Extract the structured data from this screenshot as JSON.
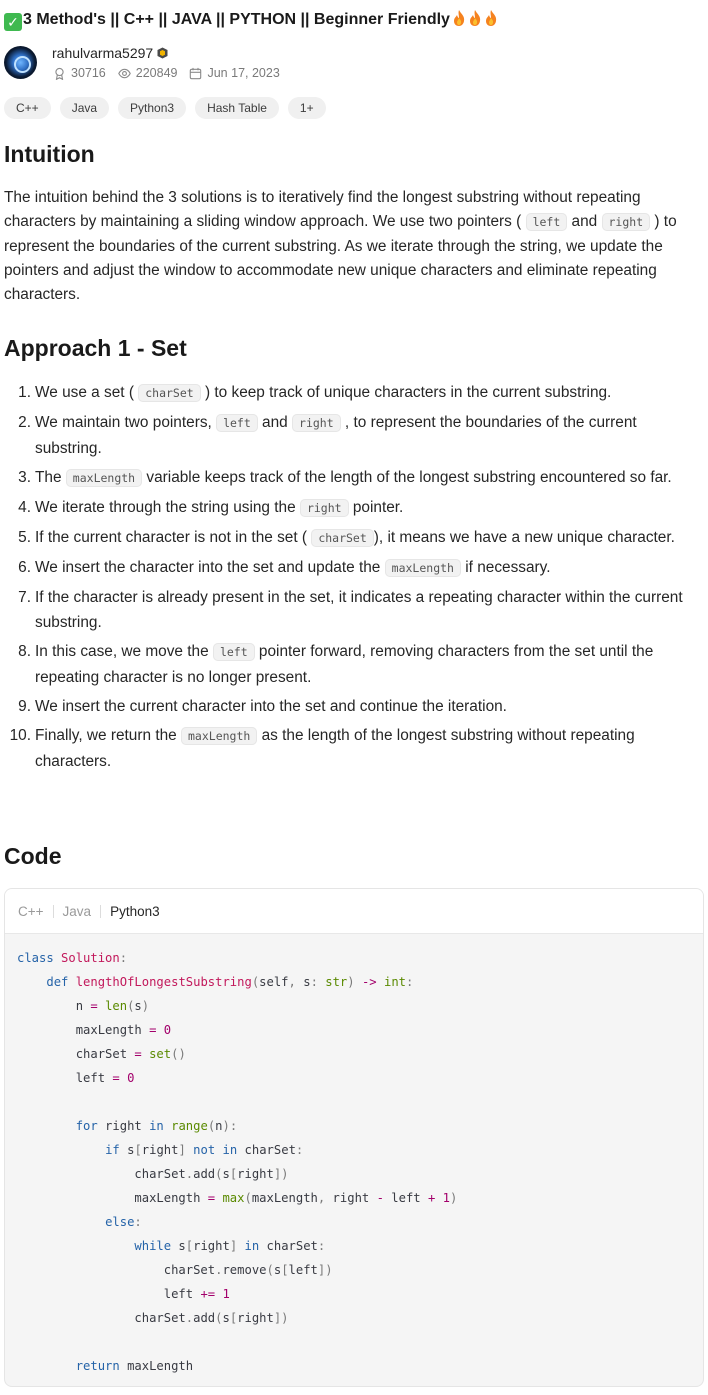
{
  "post": {
    "title": "3 Method's || C++ || JAVA || PYTHON || Beginner Friendly",
    "author": "rahulvarma5297",
    "reputation": "30716",
    "views": "220849",
    "date": "Jun 17, 2023",
    "tags": [
      "C++",
      "Java",
      "Python3",
      "Hash Table",
      "1+"
    ]
  },
  "sections": {
    "intuition_heading": "Intuition",
    "approach_heading": "Approach 1 - Set",
    "code_heading": "Code"
  },
  "intuition": {
    "t1": "The intuition behind the 3 solutions is to iteratively find the longest substring without repeating characters by maintaining a sliding window approach. We use two pointers (",
    "c1": "left",
    "t2": " and ",
    "c2": "right",
    "t3": ") to represent the boundaries of the current substring. As we iterate through the string, we update the pointers and adjust the window to accommodate new unique characters and eliminate repeating characters."
  },
  "steps": [
    {
      "num": "1.",
      "a": "We use a set (",
      "c": "charSet",
      "b": ") to keep track of unique characters in the current substring."
    },
    {
      "num": "2.",
      "a": "We maintain two pointers, ",
      "c": "left",
      "m": " and ",
      "c2": "right",
      "b": ", to represent the boundaries of the current substring."
    },
    {
      "num": "3.",
      "a": "The ",
      "c": "maxLength",
      "b": " variable keeps track of the length of the longest substring encountered so far."
    },
    {
      "num": "4.",
      "a": "We iterate through the string using the ",
      "c": "right",
      "b": " pointer."
    },
    {
      "num": "5.",
      "a": "If the current character is not in the set (",
      "c": "charSet",
      "b": "), it means we have a new unique character."
    },
    {
      "num": "6.",
      "a": "We insert the character into the set and update the ",
      "c": "maxLength",
      "b": " if necessary."
    },
    {
      "num": "7.",
      "a": "If the character is already present in the set, it indicates a repeating character within the current substring.",
      "c": "",
      "b": ""
    },
    {
      "num": "8.",
      "a": "In this case, we move the ",
      "c": "left",
      "b": " pointer forward, removing characters from the set until the repeating character is no longer present."
    },
    {
      "num": "9.",
      "a": "We insert the current character into the set and continue the iteration.",
      "c": "",
      "b": ""
    },
    {
      "num": "10.",
      "a": "Finally, we return the ",
      "c": "maxLength",
      "b": " as the length of the longest substring without repeating characters."
    }
  ],
  "code": {
    "tabs": [
      "C++",
      "Java",
      "Python3"
    ],
    "active_tab": "Python3",
    "kw_class": "class",
    "class_name": "Solution",
    "kw_def": "def",
    "func_name": "lengthOfLongestSubstring",
    "kw_for": "for",
    "kw_in": "in",
    "kw_if": "if",
    "kw_not": "not",
    "kw_else": "else",
    "kw_while": "while",
    "kw_return": "return"
  },
  "colors": {
    "keyword": "#2563a8",
    "function": "#c2185b",
    "builtin": "#5a8a00",
    "number": "#a3006b"
  }
}
